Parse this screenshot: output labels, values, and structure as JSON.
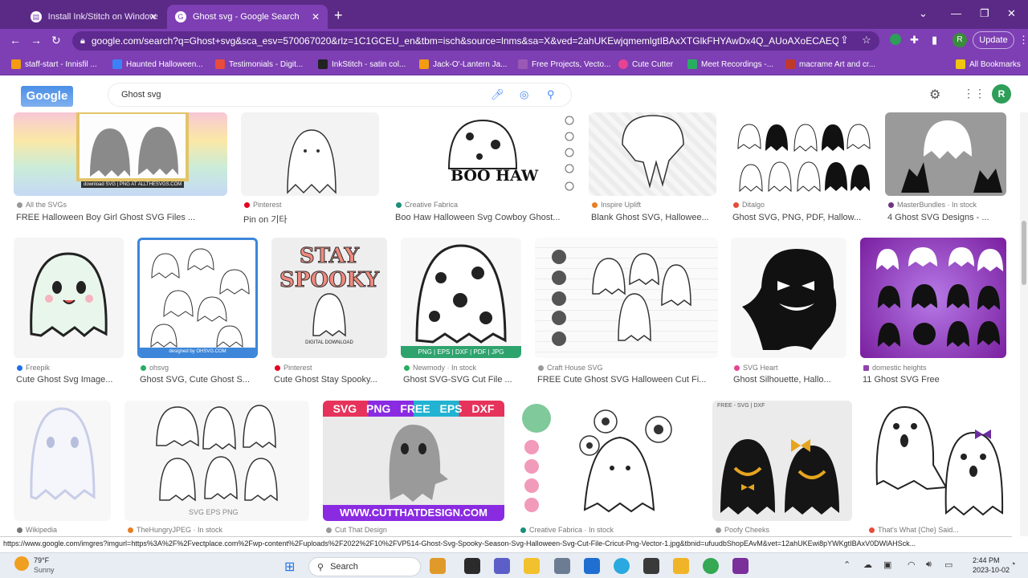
{
  "tabs": [
    {
      "label": "Install Ink/Stitch on Windows - I",
      "icon": "document-icon",
      "active": false
    },
    {
      "label": "Ghost svg - Google Search",
      "icon": "google-icon",
      "active": true
    }
  ],
  "address": {
    "url": "google.com/search?q=Ghost+svg&sca_esv=570067020&rlz=1C1GCEU_en&tbm=isch&source=lnms&sa=X&ved=2ahUKEwjqmemlgtIBAxXTGlkFHYAwDx4Q_AUoAXoECAEQAw&w&..."
  },
  "toolbar": {
    "update_label": "Update",
    "profile_letter": "R"
  },
  "bookmarks": [
    {
      "label": "staff-start - Innisfil ...",
      "color": "#f39c12"
    },
    {
      "label": "Haunted Halloween...",
      "color": "#3b82f6"
    },
    {
      "label": "Testimonials - Digit...",
      "color": "#e74c3c"
    },
    {
      "label": "InkStitch - satin col...",
      "color": "#222"
    },
    {
      "label": "Jack-O'-Lantern Ja...",
      "color": "#f39c12"
    },
    {
      "label": "Free Projects, Vecto...",
      "color": "#9b59b6"
    },
    {
      "label": "Cute Cutter",
      "color": "#e84393"
    },
    {
      "label": "Meet Recordings -...",
      "color": "#27ae60"
    },
    {
      "label": "macrame Art and cr...",
      "color": "#c0392b"
    },
    {
      "label": "All Bookmarks",
      "color": "#f1c40f"
    }
  ],
  "search": {
    "query": "Ghost svg",
    "profile_letter": "R",
    "logo_text": "Google"
  },
  "results": {
    "row1": [
      {
        "source": "All the SVGs",
        "caption": "FREE Halloween Boy Girl Ghost SVG Files ...",
        "thumb_text": "download SVG | PNG AT ALLTHESVGS.COM"
      },
      {
        "source": "Pinterest",
        "caption": "Pin on 기타",
        "thumb_text": ""
      },
      {
        "source": "Creative Fabrica",
        "caption": "Boo Haw Halloween Svg Cowboy Ghost...",
        "thumb_text": "BOO HAW"
      },
      {
        "source": "Inspire Uplift",
        "caption": "Blank Ghost SVG, Hallowee...",
        "thumb_text": ""
      },
      {
        "source": "Ditalgo",
        "caption": "Ghost SVG, PNG, PDF, Hallow...",
        "thumb_text": ""
      },
      {
        "source": "MasterBundles · In stock",
        "caption": "4 Ghost SVG Designs - ...",
        "thumb_text": ""
      }
    ],
    "row2": [
      {
        "source": "Freepik",
        "caption": "Cute Ghost Svg Image...",
        "thumb_text": ""
      },
      {
        "source": "ohsvg",
        "caption": "Ghost SVG, Cute Ghost S...",
        "thumb_text": "designed by OHSVG.COM"
      },
      {
        "source": "Pinterest",
        "caption": "Cute Ghost Stay Spooky...",
        "thumb_text": "STAY SPOOKY",
        "thumb_sub": "DIGITAL DOWNLOAD"
      },
      {
        "source": "Newmody · In stock",
        "caption": "Ghost SVG-SVG Cut File ...",
        "thumb_text": "PNG | EPS | DXF | PDF | JPG"
      },
      {
        "source": "Craft House SVG",
        "caption": "FREE Cute Ghost SVG Halloween Cut Fi...",
        "thumb_text": ""
      },
      {
        "source": "SVG Heart",
        "caption": "Ghost Silhouette, Hallo...",
        "thumb_text": ""
      },
      {
        "source": "domestic heights",
        "caption": "11 Ghost SVG Free",
        "thumb_text": ""
      }
    ],
    "row3": [
      {
        "source": "Wikipedia",
        "caption": "",
        "thumb_text": ""
      },
      {
        "source": "TheHungryJPEG · In stock",
        "caption": "",
        "thumb_text": "SVG EPS PNG"
      },
      {
        "source": "Cut That Design",
        "caption": "",
        "thumb_text": "SVG PNG FREE EPS DXF",
        "thumb_sub": "WWW.CUTTHATDESIGN.COM"
      },
      {
        "source": "Creative Fabrica · In stock",
        "caption": "",
        "thumb_text": ""
      },
      {
        "source": "Poofy Cheeks",
        "caption": "",
        "thumb_text": "FREE - SVG | DXF"
      },
      {
        "source": "That's What {Che} Said...",
        "caption": "",
        "thumb_text": ""
      }
    ]
  },
  "status_url": "https://www.google.com/imgres?imgurl=https%3A%2F%2Fvectplace.com%2Fwp-content%2Fuploads%2F2022%2F10%2FVP514-Ghost-Svg-Spooky-Season-Svg-Halloween-Svg-Cut-File-Cricut-Png-Vector-1.jpg&tbnid=ufuudbShopEAvM&vet=12ahUKEwi8pYWKgtIBAxV0DWlAHSck...",
  "taskbar": {
    "temp": "79°F",
    "weather": "Sunny",
    "search_label": "Search",
    "time": "2:44 PM",
    "date": "2023-10-02"
  }
}
